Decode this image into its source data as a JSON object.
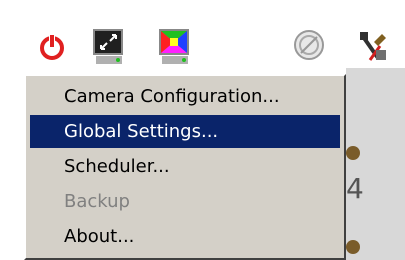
{
  "toolbar": {
    "icons": [
      "power-icon",
      "monitor-zoom-icon",
      "monitor-color-icon",
      "disabled-circle-icon",
      "tools-icon"
    ]
  },
  "background": {
    "digit": "4"
  },
  "menu": {
    "items": [
      {
        "label": "Camera Configuration...",
        "state": "normal"
      },
      {
        "label": "Global Settings...",
        "state": "selected"
      },
      {
        "label": "Scheduler...",
        "state": "normal"
      },
      {
        "label": "Backup",
        "state": "disabled"
      },
      {
        "label": "About...",
        "state": "normal"
      }
    ]
  },
  "colors": {
    "menu_bg": "#d4d0c8",
    "selection": "#0a246a",
    "power_red": "#e02020"
  }
}
